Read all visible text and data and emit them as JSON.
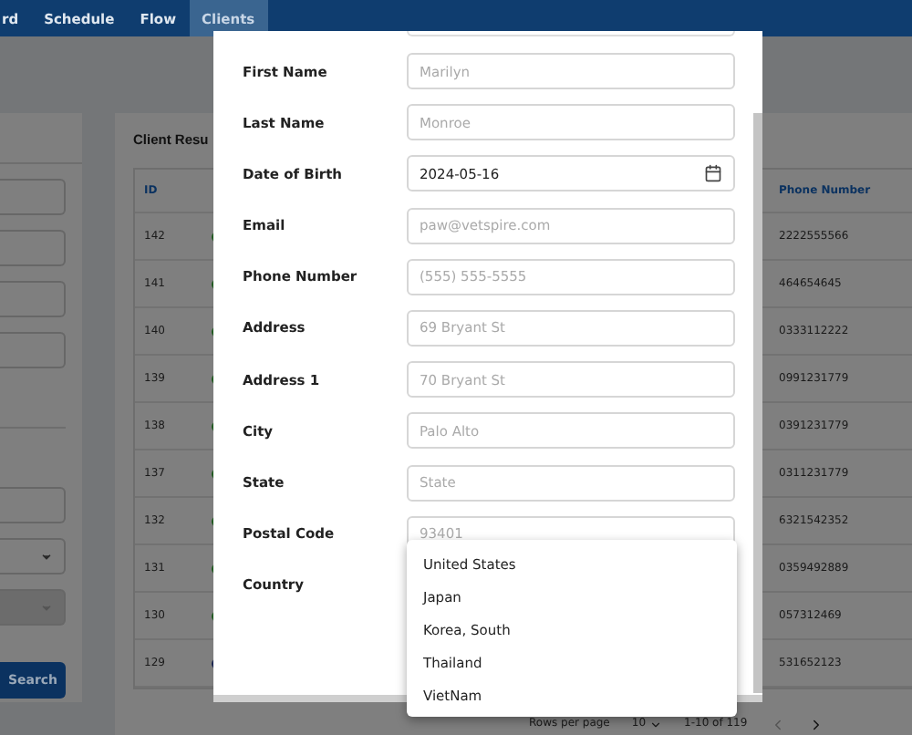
{
  "nav": {
    "items": [
      {
        "label": "rd",
        "selected": false
      },
      {
        "label": "Schedule",
        "selected": false
      },
      {
        "label": "Flow",
        "selected": false
      },
      {
        "label": "Clients",
        "selected": true
      }
    ]
  },
  "filters": {
    "fields": [
      {
        "kind": "input"
      },
      {
        "kind": "input"
      },
      {
        "kind": "input"
      },
      {
        "kind": "input"
      },
      {
        "kind": "divider"
      },
      {
        "kind": "input"
      },
      {
        "kind": "select",
        "disabled": false
      },
      {
        "kind": "select",
        "disabled": true
      }
    ],
    "button": "Search"
  },
  "results": {
    "title": "Client Resu",
    "columns": [
      "ID",
      "Phone Number"
    ],
    "rows": [
      {
        "id": "142",
        "color": "#1f5a1f",
        "phone": "2222555566"
      },
      {
        "id": "141",
        "color": "#1f5a1f",
        "phone": "464654645"
      },
      {
        "id": "140",
        "color": "#1f5a1f",
        "phone": "0333112222"
      },
      {
        "id": "139",
        "color": "#1f5a1f",
        "phone": "0991231779"
      },
      {
        "id": "138",
        "color": "#1f5a1f",
        "phone": "0391231779"
      },
      {
        "id": "137",
        "color": "#1f5a1f",
        "phone": "0311231779"
      },
      {
        "id": "132",
        "color": "#1f5a1f",
        "phone": "6321542352"
      },
      {
        "id": "131",
        "color": "#1f5a1f",
        "phone": "0359492889"
      },
      {
        "id": "130",
        "color": "#1f5a1f",
        "phone": "057312469"
      },
      {
        "id": "129",
        "color": "#1a2550",
        "phone": "531652123"
      }
    ],
    "pagination": {
      "rows_per_page_label": "Rows per page",
      "rows_per_page": "10",
      "range": "1-10 of 119"
    }
  },
  "dialog": {
    "fields": [
      {
        "label": "First Name",
        "kind": "text",
        "placeholder": "Marilyn"
      },
      {
        "label": "Last Name",
        "kind": "text",
        "placeholder": "Monroe"
      },
      {
        "label": "Date of Birth",
        "kind": "date",
        "value": "2024-05-16"
      },
      {
        "label": "Email",
        "kind": "text",
        "placeholder": "paw@vetspire.com"
      },
      {
        "label": "Phone Number",
        "kind": "text",
        "placeholder": "(555) 555-5555"
      },
      {
        "label": "Address",
        "kind": "text",
        "placeholder": "69 Bryant St"
      },
      {
        "label": "Address 1",
        "kind": "text",
        "placeholder": "70 Bryant St"
      },
      {
        "label": "City",
        "kind": "text",
        "placeholder": "Palo Alto"
      },
      {
        "label": "State",
        "kind": "text",
        "placeholder": "State"
      },
      {
        "label": "Postal Code",
        "kind": "text",
        "placeholder": "93401"
      },
      {
        "label": "Country",
        "kind": "select"
      }
    ],
    "country_options": [
      "United States",
      "Japan",
      "Korea, South",
      "Thailand",
      "VietNam"
    ]
  }
}
